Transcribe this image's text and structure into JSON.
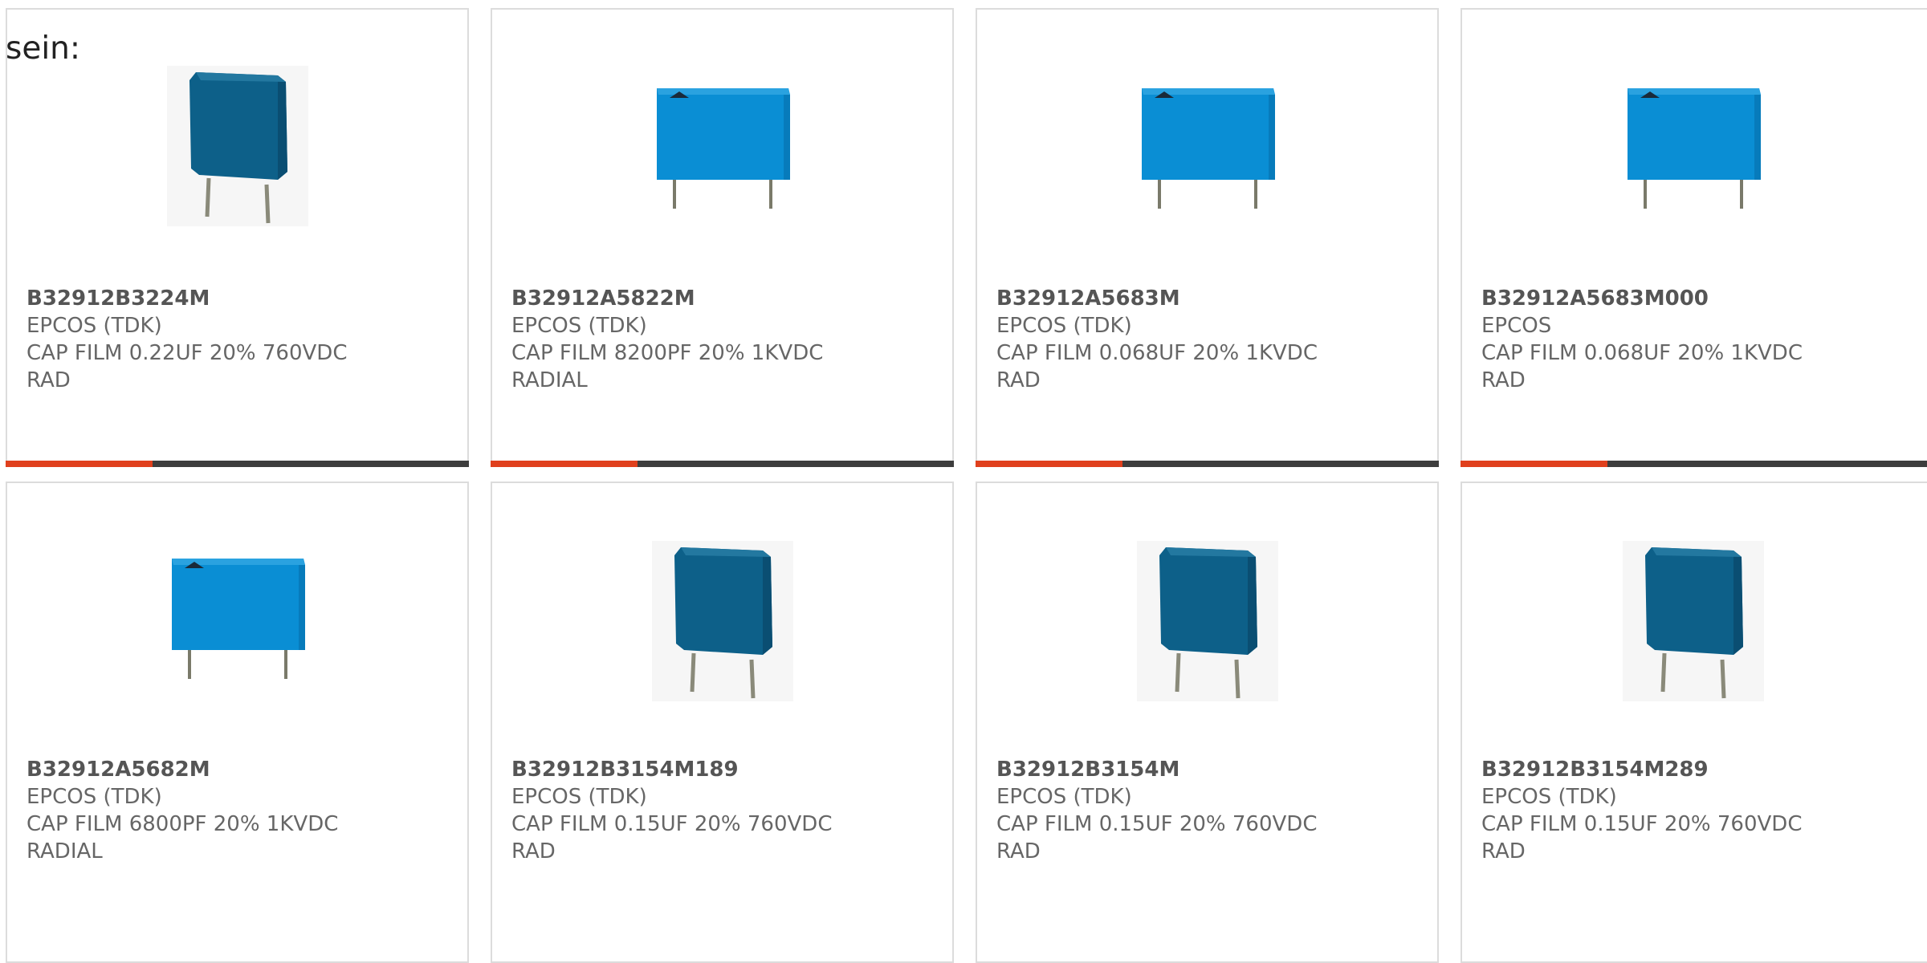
{
  "lead_text": "sein:",
  "accent_color": "#e0401d",
  "bar_color": "#3d3d3d",
  "products": [
    {
      "part_number": "B32912B3224M",
      "manufacturer": "EPCOS (TDK)",
      "desc_line1": "CAP FILM 0.22UF 20% 760VDC",
      "desc_line2": "RAD",
      "image": "dark-capacitor-tilted"
    },
    {
      "part_number": "B32912A5822M",
      "manufacturer": "EPCOS (TDK)",
      "desc_line1": "CAP FILM 8200PF 20% 1KVDC",
      "desc_line2": "RADIAL",
      "image": "light-capacitor-front"
    },
    {
      "part_number": "B32912A5683M",
      "manufacturer": "EPCOS (TDK)",
      "desc_line1": "CAP FILM 0.068UF 20% 1KVDC",
      "desc_line2": "RAD",
      "image": "light-capacitor-front"
    },
    {
      "part_number": "B32912A5683M000",
      "manufacturer": "EPCOS",
      "desc_line1": "CAP FILM 0.068UF 20% 1KVDC",
      "desc_line2": "RAD",
      "image": "light-capacitor-front"
    },
    {
      "part_number": "B32912A5682M",
      "manufacturer": "EPCOS (TDK)",
      "desc_line1": "CAP FILM 6800PF 20% 1KVDC",
      "desc_line2": "RADIAL",
      "image": "light-capacitor-front"
    },
    {
      "part_number": "B32912B3154M189",
      "manufacturer": "EPCOS (TDK)",
      "desc_line1": "CAP FILM 0.15UF 20% 760VDC",
      "desc_line2": "RAD",
      "image": "dark-capacitor-tilted"
    },
    {
      "part_number": "B32912B3154M",
      "manufacturer": "EPCOS (TDK)",
      "desc_line1": "CAP FILM 0.15UF 20% 760VDC",
      "desc_line2": "RAD",
      "image": "dark-capacitor-tilted"
    },
    {
      "part_number": "B32912B3154M289",
      "manufacturer": "EPCOS (TDK)",
      "desc_line1": "CAP FILM 0.15UF 20% 760VDC",
      "desc_line2": "RAD",
      "image": "dark-capacitor-tilted"
    }
  ]
}
